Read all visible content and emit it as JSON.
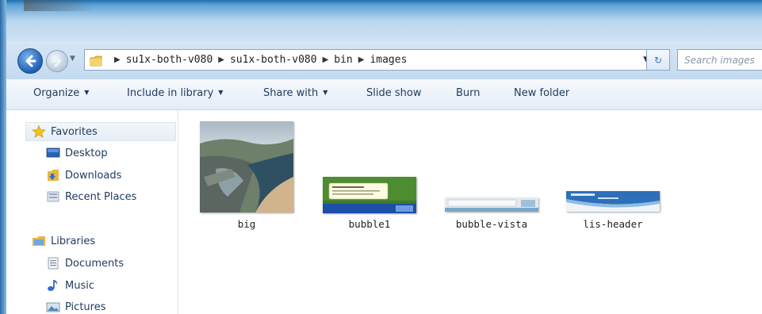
{
  "navigation": {
    "breadcrumbs": [
      "su1x-both-v080",
      "su1x-both-v080",
      "bin",
      "images"
    ],
    "search_placeholder": "Search images"
  },
  "toolbar": {
    "organize": "Organize",
    "include_in_library": "Include in library",
    "share_with": "Share with",
    "slide_show": "Slide show",
    "burn": "Burn",
    "new_folder": "New folder"
  },
  "sidebar": {
    "favorites": {
      "header": "Favorites",
      "items": [
        "Desktop",
        "Downloads",
        "Recent Places"
      ]
    },
    "libraries": {
      "header": "Libraries",
      "items": [
        "Documents",
        "Music",
        "Pictures"
      ]
    }
  },
  "files": [
    {
      "name": "big",
      "icon": "photo-thumbnail"
    },
    {
      "name": "bubble1",
      "icon": "notification-bubble-thumbnail"
    },
    {
      "name": "bubble-vista",
      "icon": "notification-bubble-thumbnail"
    },
    {
      "name": "lis-header",
      "icon": "banner-thumbnail"
    }
  ],
  "colors": {
    "frame": "#5fa3d8",
    "text": "#1e3a5f",
    "accent": "#1f5fb4"
  }
}
